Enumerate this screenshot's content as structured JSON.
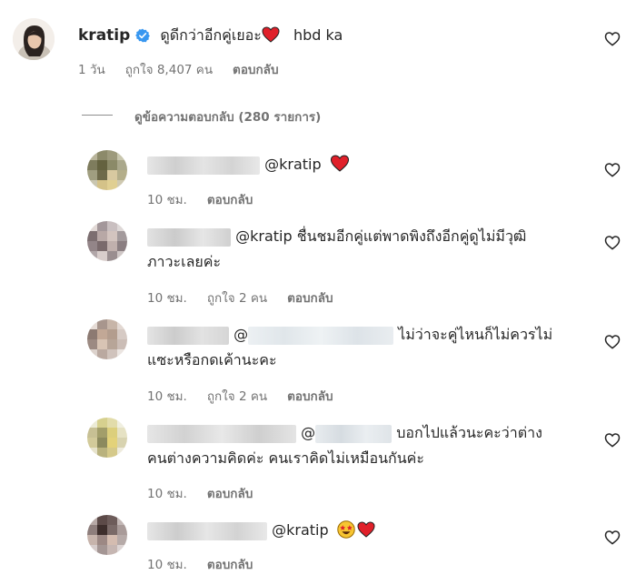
{
  "colors": {
    "accent_verified": "#3897f0",
    "heart_red": "#e0202a",
    "meta_gray": "#737373",
    "text": "#262626"
  },
  "main_comment": {
    "username": "kratip",
    "verified_icon": "verified-badge-icon",
    "text": "ดูดีกว่าอีกคู่เยอะ",
    "emoji_icon": "red-heart-emoji-icon",
    "text_after": "hbd ka",
    "time": "1 วัน",
    "likes": "ถูกใจ 8,407 คน",
    "reply_label": "ตอบกลับ",
    "like_icon": "heart-outline-icon"
  },
  "view_replies": {
    "label": "ดูข้อความตอบกลับ (280 รายการ)"
  },
  "replies": [
    {
      "mention": "@kratip",
      "emoji_icon": "red-heart-emoji-icon",
      "time": "10 ชม.",
      "reply_label": "ตอบกลับ"
    },
    {
      "mention": "@kratip",
      "text_line1": "ชื่นชมอีกคู่แต่พาดพิงถึงอีกคู่ดูไม่มีวุฒิ",
      "text_line2": "ภาวะเลยค่ะ",
      "time": "10 ชม.",
      "likes": "ถูกใจ 2 คน",
      "reply_label": "ตอบกลับ"
    },
    {
      "mention": "@",
      "text_line1": "ไม่ว่าจะคู่ไหนก็ไม่ควรไม่",
      "text_line2": "แซะหรือกดเค้านะคะ",
      "time": "10 ชม.",
      "likes": "ถูกใจ 2 คน",
      "reply_label": "ตอบกลับ"
    },
    {
      "mention": "@",
      "text_line1": "บอกไปแล้วนะคะว่าต่าง",
      "text_line2": "คนต่างความคิดค่ะ คนเราคิดไม่เหมือนกันค่ะ",
      "time": "10 ชม.",
      "reply_label": "ตอบกลับ"
    },
    {
      "mention": "@kratip",
      "emoji_icons": [
        "star-struck-emoji-icon",
        "red-heart-emoji-icon"
      ],
      "time": "10 ชม.",
      "reply_label": "ตอบกลับ"
    }
  ]
}
